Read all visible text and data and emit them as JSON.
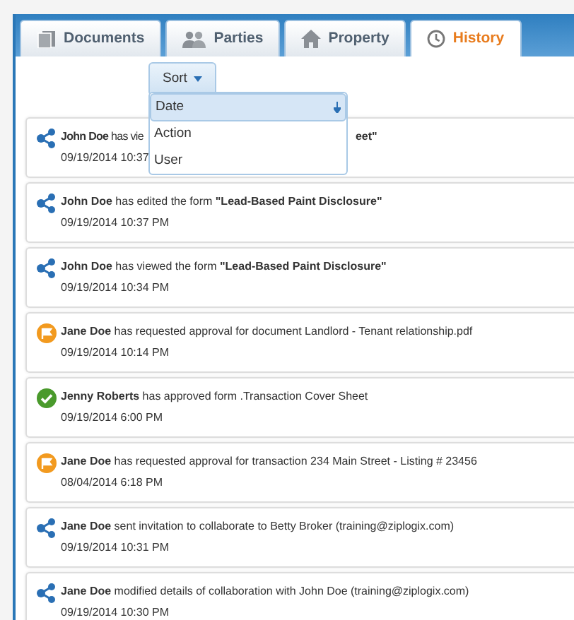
{
  "tabs": [
    {
      "label": "Documents",
      "selected": false
    },
    {
      "label": "Parties",
      "selected": false
    },
    {
      "label": "Property",
      "selected": false
    },
    {
      "label": "History",
      "selected": true
    }
  ],
  "sort": {
    "label": "Sort",
    "expanded": true,
    "options": [
      {
        "label": "Date",
        "selected": true
      },
      {
        "label": "Action",
        "selected": false
      },
      {
        "label": "User",
        "selected": false
      }
    ]
  },
  "events": [
    {
      "kind": "share",
      "message_parts": [
        "**John Doe** has vie",
        "**eet\"**"
      ],
      "time": "09/19/2014 10:37"
    },
    {
      "kind": "share",
      "message": "**John Doe** has edited the form **\"Lead-Based Paint Disclosure\"**",
      "time": "09/19/2014 10:37 PM"
    },
    {
      "kind": "share",
      "message": "**John Doe** has viewed the form **\"Lead-Based Paint Disclosure\"**",
      "time": "09/19/2014 10:34 PM"
    },
    {
      "kind": "flag",
      "message": "**Jane Doe** has requested approval for document Landlord - Tenant relationship.pdf",
      "time": "09/19/2014 10:14 PM"
    },
    {
      "kind": "approved",
      "message": "**Jenny Roberts** has approved form .Transaction Cover Sheet",
      "time": "09/19/2014 6:00 PM"
    },
    {
      "kind": "flag",
      "message": "**Jane Doe** has requested approval for transaction 234 Main Street - Listing # 23456",
      "time": "08/04/2014 6:18 PM"
    },
    {
      "kind": "share",
      "message": "**Jane Doe** sent invitation to collaborate to Betty Broker (training@ziplogix.com)",
      "time": "09/19/2014 10:31 PM"
    },
    {
      "kind": "share",
      "message": "**Jane Doe** modified details of collaboration with John Doe (training@ziplogix.com)",
      "time": "09/19/2014 10:30 PM"
    }
  ]
}
